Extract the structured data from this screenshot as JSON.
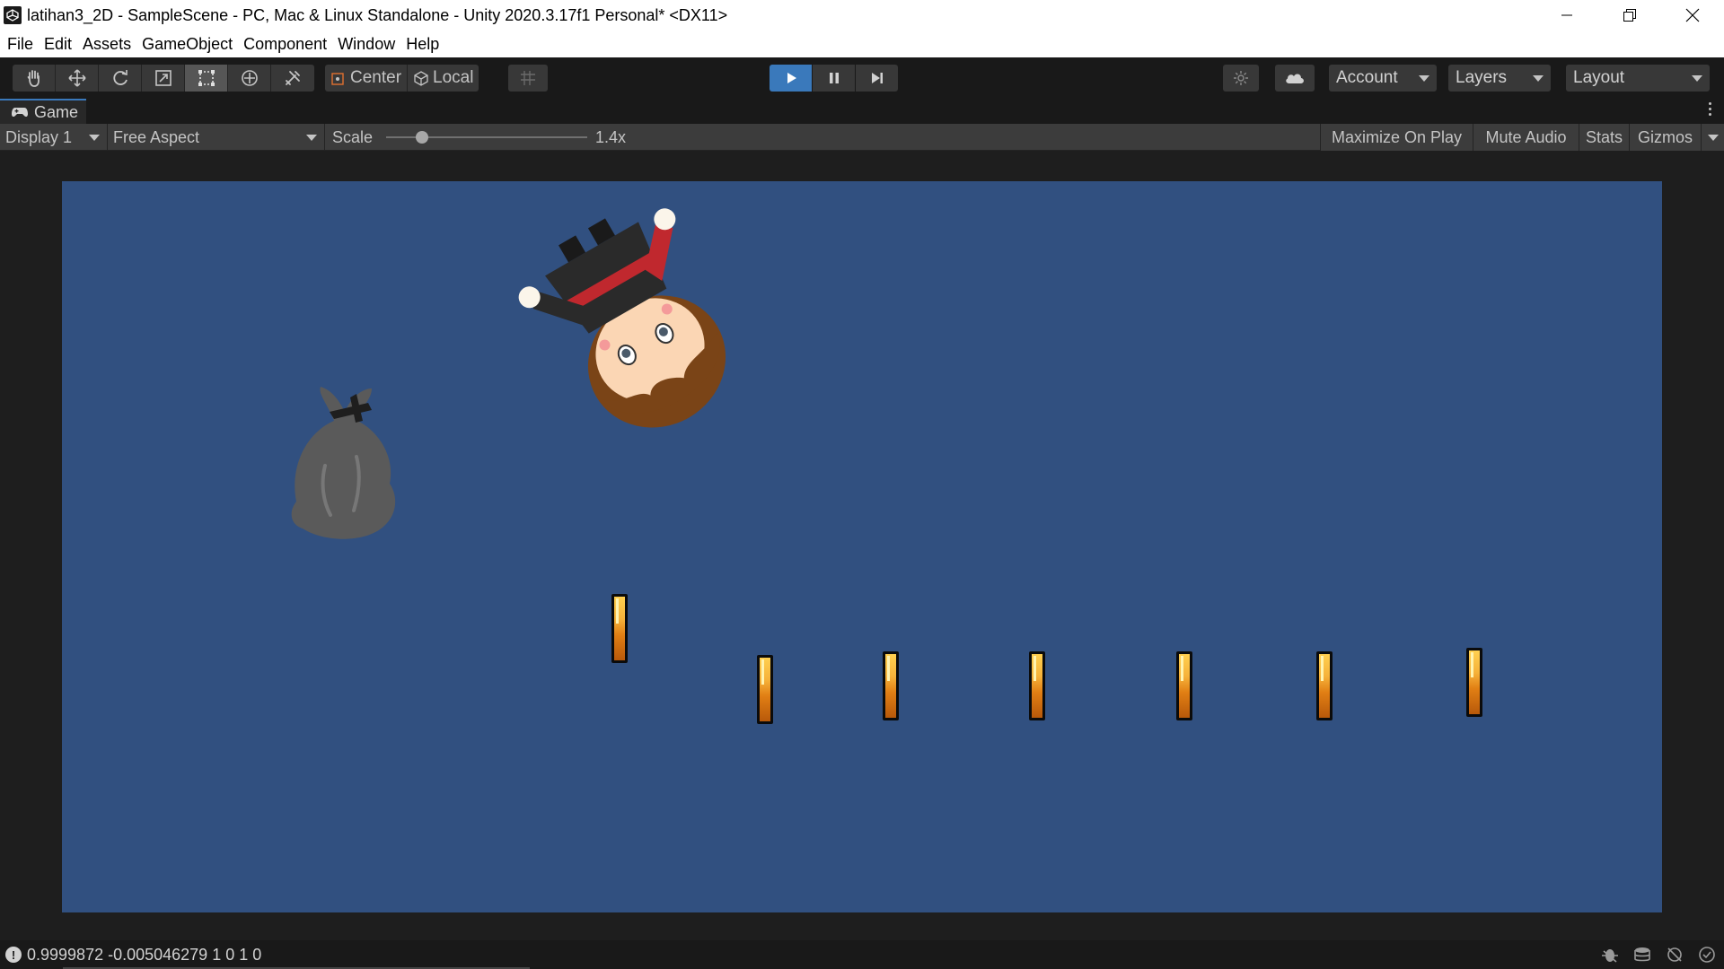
{
  "window": {
    "title": "latihan3_2D - SampleScene - PC, Mac & Linux Standalone - Unity 2020.3.17f1 Personal* <DX11>",
    "icons": [
      "unity-logo-icon",
      "minimize-icon",
      "restore-icon",
      "close-icon"
    ]
  },
  "menu": [
    "File",
    "Edit",
    "Assets",
    "GameObject",
    "Component",
    "Window",
    "Help"
  ],
  "toolbar": {
    "tools": [
      "hand-tool-icon",
      "move-tool-icon",
      "rotate-tool-icon",
      "scale-tool-icon",
      "rect-tool-icon",
      "transform-tool-icon",
      "custom-tool-icon"
    ],
    "active_tool": "rect-tool-icon",
    "pivot_label": "Center",
    "rotation_label": "Local",
    "play_state": "playing",
    "account_label": "Account",
    "layers_label": "Layers",
    "layout_label": "Layout",
    "accent_color": "#3a79bb"
  },
  "game_tab": {
    "label": "Game"
  },
  "game_controls": {
    "display": "Display 1",
    "aspect": "Free Aspect",
    "scale_label": "Scale",
    "scale_value": "1.4x",
    "scale_fraction": 0.18,
    "maximize_label": "Maximize On Play",
    "mute_label": "Mute Audio",
    "stats_label": "Stats",
    "gizmos_label": "Gizmos"
  },
  "scene": {
    "background_color": "#315080",
    "objects": [
      "player-character",
      "trash-bag",
      "coin",
      "coin",
      "coin",
      "coin",
      "coin",
      "coin",
      "coin"
    ]
  },
  "status": {
    "message": "0.9999872 -0.005046279 1 0 1 0"
  }
}
